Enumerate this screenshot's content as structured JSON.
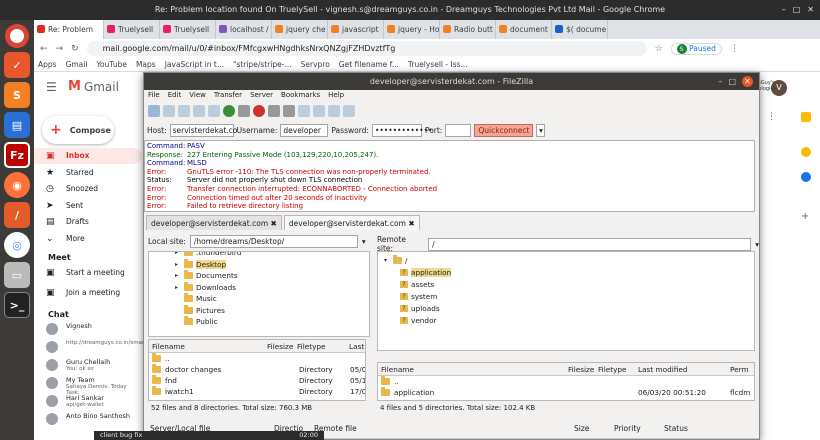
{
  "topbar": {
    "title": "Re: Problem location found On TruelySell - vignesh.s@dreamguys.co.in - Dreamguys Technologies Pvt Ltd Mail - Google Chrome"
  },
  "tabs": [
    {
      "label": "Re: Problem",
      "color": "#d93025"
    },
    {
      "label": "Truelysell",
      "color": "#e91e63"
    },
    {
      "label": "Truelysell",
      "color": "#e91e63"
    },
    {
      "label": "localhost /",
      "color": "#7e57c2"
    },
    {
      "label": "jquery che",
      "color": "#f48024"
    },
    {
      "label": "javascript",
      "color": "#f48024"
    },
    {
      "label": "jquery - Ho",
      "color": "#f48024"
    },
    {
      "label": "Radio butt",
      "color": "#f48024"
    },
    {
      "label": "document",
      "color": "#f48024"
    },
    {
      "label": "$( docume",
      "color": "#1565c0"
    }
  ],
  "address": {
    "url": "mail.google.com/mail/u/0/#inbox/FMfcgxwHNgdhksNrxQNZgjFZHDvztfTg",
    "paused_label": "Paused",
    "avatar": "S"
  },
  "bookmarks": [
    "Apps",
    "Gmail",
    "YouTube",
    "Maps",
    "JavaScript in t...",
    "\"stripe/stripe-...",
    "Servpro",
    "Get filename f...",
    "Truelysell - Iss..."
  ],
  "gmail": {
    "brand": "Gmail",
    "compose": "Compose",
    "nav": [
      {
        "label": "Inbox",
        "icon": "▣",
        "active": true
      },
      {
        "label": "Starred",
        "icon": "★"
      },
      {
        "label": "Snoozed",
        "icon": "◷"
      },
      {
        "label": "Sent",
        "icon": "➤"
      },
      {
        "label": "Drafts",
        "icon": "▤"
      },
      {
        "label": "More",
        "icon": "⌄"
      }
    ],
    "meet_heading": "Meet",
    "meet": [
      "Start a meeting",
      "Join a meeting"
    ],
    "chat_heading": "Chat",
    "chats": [
      {
        "name": "Vignesh",
        "sub": ""
      },
      {
        "name": "",
        "sub": "http://dreamguys.co.in/smartfix"
      },
      {
        "name": "Guru Chellaih",
        "sub": "You: ok sir"
      },
      {
        "name": "My Team",
        "sub": "Sahaya Dennis: Today Task:"
      },
      {
        "name": "Hari Sankar",
        "sub": "api/get-wallet"
      },
      {
        "name": "Anto Bino Santhosh",
        "sub": ""
      }
    ],
    "right_avatar": "V",
    "company": "DreamGuy's Technologies"
  },
  "filezilla": {
    "title": "developer@servisterdekat.com - FileZilla",
    "menu": [
      "File",
      "Edit",
      "View",
      "Transfer",
      "Server",
      "Bookmarks",
      "Help"
    ],
    "quick": {
      "host_label": "Host:",
      "host": "servisterdekat.co",
      "user_label": "Username:",
      "user": "developer",
      "pass_label": "Password:",
      "pass": "•••••••••••••",
      "port_label": "Port:",
      "port": "",
      "connect": "Quickconnect"
    },
    "log": [
      {
        "k": "Command:",
        "v": "PASV",
        "t": "cmd"
      },
      {
        "k": "Response:",
        "v": "227 Entering Passive Mode (103,129,220,10,205,247).",
        "t": "res"
      },
      {
        "k": "Command:",
        "v": "MLSD",
        "t": "cmd"
      },
      {
        "k": "Error:",
        "v": "GnuTLS error -110: The TLS connection was non-properly terminated.",
        "t": "err"
      },
      {
        "k": "Status:",
        "v": "Server did not properly shut down TLS connection",
        "t": "st"
      },
      {
        "k": "Error:",
        "v": "Transfer connection interrupted: ECONNABORTED - Connection aborted",
        "t": "err"
      },
      {
        "k": "Error:",
        "v": "Connection timed out after 20 seconds of inactivity",
        "t": "err"
      },
      {
        "k": "Error:",
        "v": "Failed to retrieve directory listing",
        "t": "err"
      }
    ],
    "site_tabs": [
      "developer@servisterdekat.com",
      "developer@servisterdekat.com"
    ],
    "local": {
      "label": "Local site:",
      "path": "/home/dreams/Desktop/",
      "tree": [
        ".thunderbird",
        "Desktop",
        "Documents",
        "Downloads",
        "Music",
        "Pictures",
        "Public"
      ],
      "headers": [
        "Filename",
        "Filesize",
        "Filetype",
        "Last"
      ],
      "files": [
        {
          "name": "..",
          "size": "",
          "type": "",
          "date": ""
        },
        {
          "name": "doctor changes",
          "size": "",
          "type": "Directory",
          "date": "05/0"
        },
        {
          "name": "fnd",
          "size": "",
          "type": "Directory",
          "date": "05/1"
        },
        {
          "name": "iwatch1",
          "size": "",
          "type": "Directory",
          "date": "17/0"
        }
      ],
      "status": "52 files and 8 directories. Total size: 760.3 MB"
    },
    "remote": {
      "label": "Remote site:",
      "path": "/",
      "tree_root": "/",
      "tree": [
        "application",
        "assets",
        "system",
        "uploads",
        "vendor"
      ],
      "headers": [
        "Filename",
        "Filesize",
        "Filetype",
        "Last modified",
        "Perm"
      ],
      "files": [
        {
          "name": "..",
          "size": "",
          "type": "",
          "date": "",
          "perm": ""
        },
        {
          "name": "application",
          "size": "",
          "type": "",
          "date": "06/03/20 00:51:20",
          "perm": "flcdm"
        }
      ],
      "status": "4 files and 5 directories. Total size: 102.4 KB"
    },
    "queue_headers": [
      "Server/Local file",
      "Directio",
      "Remote file",
      "Size",
      "Priority",
      "Status"
    ]
  },
  "mini_window": {
    "label": "client bug fix",
    "time": "02:00"
  }
}
